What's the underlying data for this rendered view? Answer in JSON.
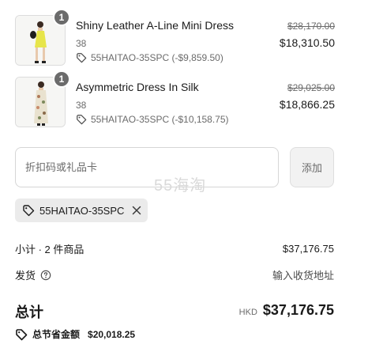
{
  "items": [
    {
      "quantity": "1",
      "name": "Shiny Leather A-Line Mini Dress",
      "size": "38",
      "discount": "55HAITAO-35SPC (-$9,859.50)",
      "original_price": "$28,170.00",
      "price": "$18,310.50",
      "thumbnail": "yellow-mini-dress-photo"
    },
    {
      "quantity": "1",
      "name": "Asymmetric Dress In Silk",
      "size": "38",
      "discount": "55HAITAO-35SPC (-$10,158.75)",
      "original_price": "$29,025.00",
      "price": "$18,866.25",
      "thumbnail": "floral-silk-dress-photo"
    }
  ],
  "discount_form": {
    "placeholder": "折扣码或礼品卡",
    "value": "",
    "apply_label": "添加"
  },
  "watermark": "55海淘",
  "applied_code": {
    "code": "55HAITAO-35SPC"
  },
  "summary": {
    "subtotal_label": "小计 · 2 件商品",
    "subtotal_value": "$37,176.75",
    "shipping_label": "发货",
    "shipping_value": "输入收货地址",
    "total_label": "总计",
    "currency": "HKD",
    "total_value": "$37,176.75",
    "savings_label": "总节省金额",
    "savings_value": "$20,018.25"
  },
  "icons": {
    "tag": "tag-icon",
    "help": "help-circle-icon",
    "close": "close-icon"
  }
}
